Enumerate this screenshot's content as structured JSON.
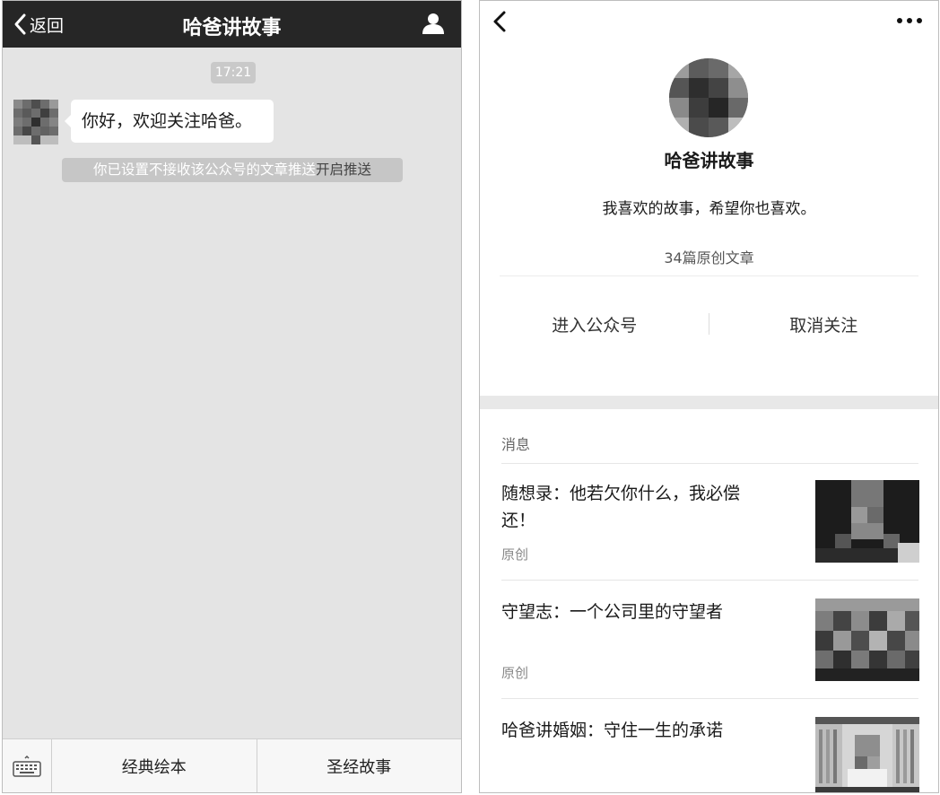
{
  "chat": {
    "back_label": "返回",
    "title": "哈爸讲故事",
    "timestamp": "17:21",
    "message": "你好，欢迎关注哈爸。",
    "notice_text": "你已设置不接收该公众号的文章推送",
    "notice_link": "开启推送",
    "menu": [
      "经典绘本",
      "圣经故事"
    ]
  },
  "profile": {
    "name": "哈爸讲故事",
    "bio": "我喜欢的故事，希望你也喜欢。",
    "article_count": "34篇原创文章",
    "actions": [
      "进入公众号",
      "取消关注"
    ],
    "section_title": "消息",
    "articles": [
      {
        "title": "随想录：他若欠你什么，我必偿还！",
        "tag": "原创"
      },
      {
        "title": "守望志：一个公司里的守望者",
        "tag": "原创"
      },
      {
        "title": "哈爸讲婚姻：守住一生的承诺",
        "tag": ""
      }
    ]
  },
  "colors": {
    "chat_header_bg": "#262626",
    "chat_bg": "#e4e4e4",
    "bubble_bg": "#ffffff",
    "notice_bg": "#c6c6c6"
  },
  "icons": [
    "chevron-left-icon",
    "person-icon",
    "keyboard-icon",
    "more-icon"
  ]
}
